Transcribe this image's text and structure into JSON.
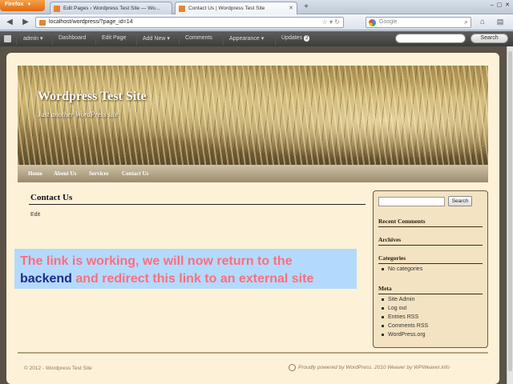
{
  "browser": {
    "app_button": "Firefox",
    "tabs": [
      {
        "title": "Edit Pages ‹ Wordpress Test Site — Wo..."
      },
      {
        "title": "Contact Us | Wordpress Test Site"
      }
    ],
    "url": "localhost/wordpress/?page_id=14",
    "search_placeholder": "Google"
  },
  "adminbar": {
    "items": [
      "admin",
      "Dashboard",
      "Edit Page",
      "Add New",
      "Comments",
      "Appearance",
      "Updates"
    ],
    "updates_count": "2",
    "search_button": "Search"
  },
  "site": {
    "title": "Wordpress Test Site",
    "tagline": "Just another WordPress site",
    "menu": [
      "Home",
      "About Us",
      "Services",
      "Contact Us"
    ]
  },
  "content": {
    "title": "Contact Us",
    "edit_link": "Edit"
  },
  "sidebar": {
    "search_button": "Search",
    "recent_comments": "Recent Comments",
    "archives": "Archives",
    "categories": "Categories",
    "categories_items": [
      "No categories"
    ],
    "meta": "Meta",
    "meta_items": [
      "Site Admin",
      "Log out",
      "Entries RSS",
      "Comments RSS",
      "WordPress.org"
    ]
  },
  "footer": {
    "left": "© 2012 - Wordpress Test Site",
    "right": "Proudly powered by WordPress. 2010 Weaver by WPWeaver.info"
  },
  "overlay": {
    "line1": "The link is working, we will now return to the",
    "line2_highlight": "backend",
    "line2_rest": " and redirect this link to an external site"
  }
}
